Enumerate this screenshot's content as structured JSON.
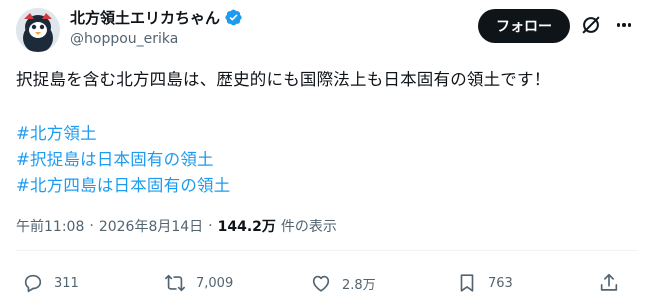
{
  "user": {
    "display_name": "北方領土エリカちゃん",
    "handle": "@hoppou_erika",
    "verified": true
  },
  "header": {
    "follow_label": "フォロー"
  },
  "post": {
    "text": "択捉島を含む北方四島は、歴史的にも国際法上も日本固有の領土です！",
    "hashtags": [
      "#北方領土",
      "#択捉島は日本固有の領土",
      "#北方四島は日本固有の領土"
    ]
  },
  "meta": {
    "time": "午前11:08",
    "separator": "·",
    "date": "2026年8月14日",
    "views_count": "144.2万",
    "views_label": "件の表示"
  },
  "actions": {
    "replies": "311",
    "reposts": "7,009",
    "likes": "2.8万",
    "bookmarks": "763"
  },
  "colors": {
    "accent": "#1d9bf0",
    "text": "#0f1419",
    "muted": "#536471",
    "follow_button_bg": "#0f1419"
  },
  "icons": {
    "verified": "verified-badge-icon",
    "grok": "grok-icon",
    "more": "more-icon",
    "reply": "reply-icon",
    "repost": "repost-icon",
    "like": "like-icon",
    "bookmark": "bookmark-icon",
    "share": "share-icon"
  }
}
